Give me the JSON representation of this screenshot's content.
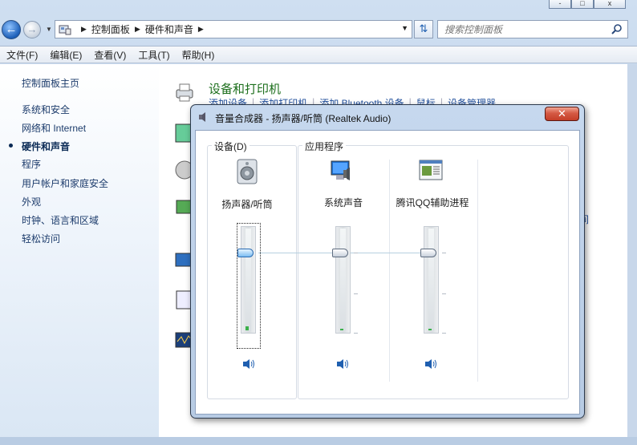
{
  "control_panel": {
    "caption_buttons": [
      "-",
      "□",
      "x"
    ],
    "breadcrumb": [
      "控制面板",
      "硬件和声音"
    ],
    "search_placeholder": "搜索控制面板",
    "menu": [
      "文件(F)",
      "编辑(E)",
      "查看(V)",
      "工具(T)",
      "帮助(H)"
    ],
    "sidebar": {
      "home": "控制面板主页",
      "items": [
        "系统和安全",
        "网络和 Internet",
        "硬件和声音",
        "程序",
        "用户帐户和家庭安全",
        "外观",
        "时钟、语言和区域",
        "轻松访问"
      ],
      "active_index": 2
    },
    "section": {
      "title": "设备和打印机",
      "links": [
        "添加设备",
        "添加打印机",
        "添加 Bluetooth 设备",
        "鼠标",
        "设备管理器"
      ]
    },
    "partial_right_text": "间"
  },
  "mixer": {
    "title": "音量合成器 - 扬声器/听筒 (Realtek Audio)",
    "close_label": "✕",
    "device_group_label": "设备(D)",
    "apps_group_label": "应用程序",
    "channels": [
      {
        "name": "扬声器/听筒",
        "icon": "speaker-device-icon",
        "volume": 78,
        "peak": 2
      },
      {
        "name": "系统声音",
        "icon": "system-sounds-icon",
        "volume": 78,
        "peak": 0
      },
      {
        "name": "腾讯QQ辅助进程",
        "icon": "app-window-icon",
        "volume": 78,
        "peak": 0
      }
    ]
  },
  "colors": {
    "accent_link": "#1f4e9b",
    "section_title": "#1d6f1d",
    "close_red": "#c43d27"
  }
}
